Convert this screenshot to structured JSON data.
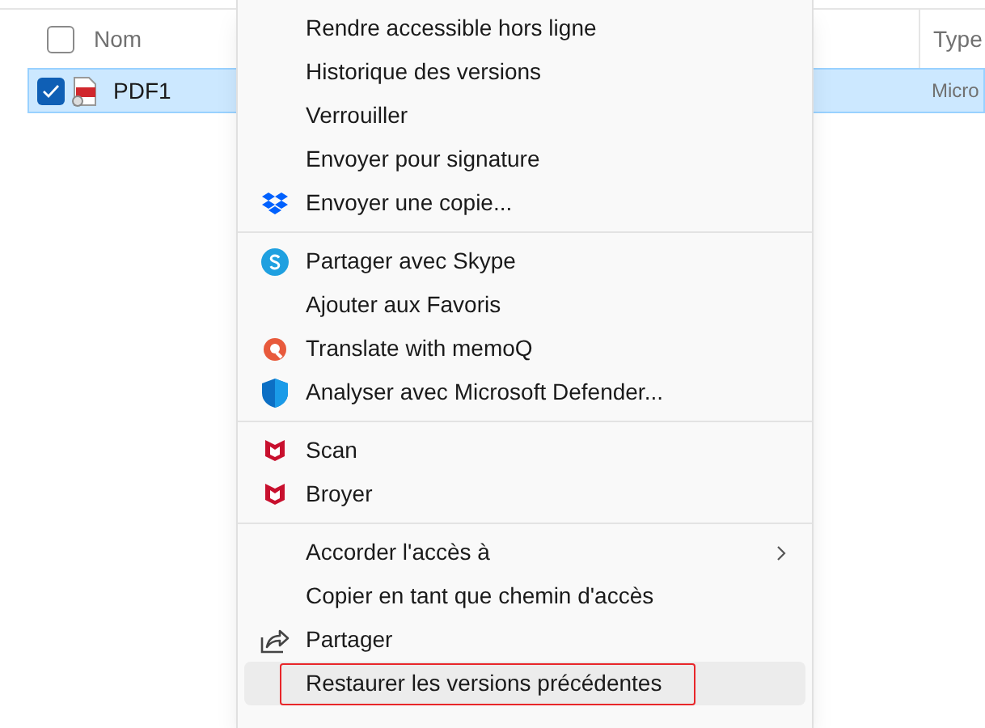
{
  "file_list": {
    "columns": [
      {
        "label": "Nom"
      },
      {
        "label": "Type"
      }
    ],
    "header_checked": false,
    "rows": [
      {
        "name": "PDF1",
        "type": "Micro",
        "selected": true,
        "checked": true
      }
    ]
  },
  "context_menu": {
    "groups": [
      {
        "items": [
          {
            "label": "Rendre accessible hors ligne",
            "kind": "plain",
            "submenu": false,
            "selected": false,
            "outlined": false
          },
          {
            "label": "Historique des versions",
            "kind": "plain",
            "submenu": false,
            "selected": false,
            "outlined": false
          },
          {
            "label": "Verrouiller",
            "kind": "plain",
            "submenu": false,
            "selected": false,
            "outlined": false
          },
          {
            "label": "Envoyer pour signature",
            "kind": "plain",
            "submenu": false,
            "selected": false,
            "outlined": false
          },
          {
            "label": "Envoyer une copie...",
            "kind": "dropbox",
            "submenu": false,
            "selected": false,
            "outlined": false
          }
        ]
      },
      {
        "items": [
          {
            "label": "Partager avec Skype",
            "kind": "skype",
            "submenu": false,
            "selected": false,
            "outlined": false
          },
          {
            "label": "Ajouter aux Favoris",
            "kind": "plain",
            "submenu": false,
            "selected": false,
            "outlined": false
          },
          {
            "label": "Translate with memoQ",
            "kind": "memoq",
            "submenu": false,
            "selected": false,
            "outlined": false
          },
          {
            "label": "Analyser avec Microsoft Defender...",
            "kind": "defender",
            "submenu": false,
            "selected": false,
            "outlined": false
          }
        ]
      },
      {
        "items": [
          {
            "label": "Scan",
            "kind": "mcafee",
            "submenu": false,
            "selected": false,
            "outlined": false
          },
          {
            "label": "Broyer",
            "kind": "mcafee",
            "submenu": false,
            "selected": false,
            "outlined": false
          }
        ]
      },
      {
        "items": [
          {
            "label": "Accorder l'accès à",
            "kind": "plain",
            "submenu": true,
            "selected": false,
            "outlined": false
          },
          {
            "label": "Copier en tant que chemin d'accès",
            "kind": "plain",
            "submenu": false,
            "selected": false,
            "outlined": false
          },
          {
            "label": "Partager",
            "kind": "share",
            "submenu": false,
            "selected": false,
            "outlined": false
          },
          {
            "label": "Restaurer les versions précédentes",
            "kind": "plain",
            "submenu": false,
            "selected": true,
            "outlined": true
          }
        ]
      }
    ]
  }
}
